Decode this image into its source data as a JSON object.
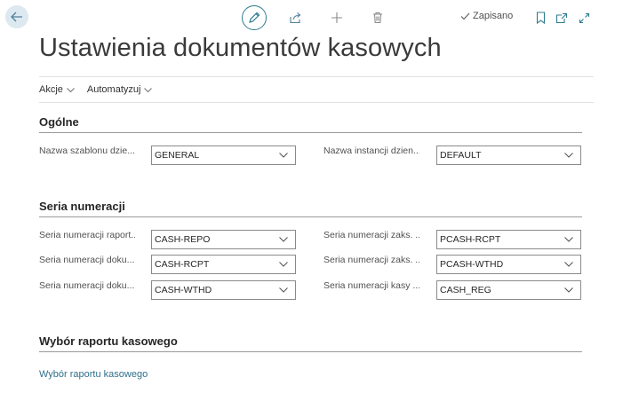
{
  "header": {
    "saved_label": "Zapisano"
  },
  "page": {
    "title": "Ustawienia dokumentów kasowych"
  },
  "actions": [
    {
      "label": "Akcje"
    },
    {
      "label": "Automatyzuj"
    }
  ],
  "sections": {
    "general": {
      "title": "Ogólne",
      "fields": [
        {
          "label": "Nazwa szablonu dzie...",
          "value": "GENERAL"
        },
        {
          "label": "Nazwa instancji dzien...",
          "value": "DEFAULT"
        }
      ]
    },
    "numbering": {
      "title": "Seria numeracji",
      "fields": [
        {
          "label": "Seria numeracji raport...",
          "value": "CASH-REPO"
        },
        {
          "label": "Seria numeracji zaks. ...",
          "value": "PCASH-RCPT"
        },
        {
          "label": "Seria numeracji doku...",
          "value": "CASH-RCPT"
        },
        {
          "label": "Seria numeracji zaks. ...",
          "value": "PCASH-WTHD"
        },
        {
          "label": "Seria numeracji doku...",
          "value": "CASH-WTHD"
        },
        {
          "label": "Seria numeracji kasy ...",
          "value": "CASH_REG"
        }
      ]
    },
    "report": {
      "title": "Wybór raportu kasowego",
      "link": "Wybór raportu kasowego"
    }
  },
  "colors": {
    "accent": "#2f7d8f",
    "link": "#2e6f8c"
  }
}
